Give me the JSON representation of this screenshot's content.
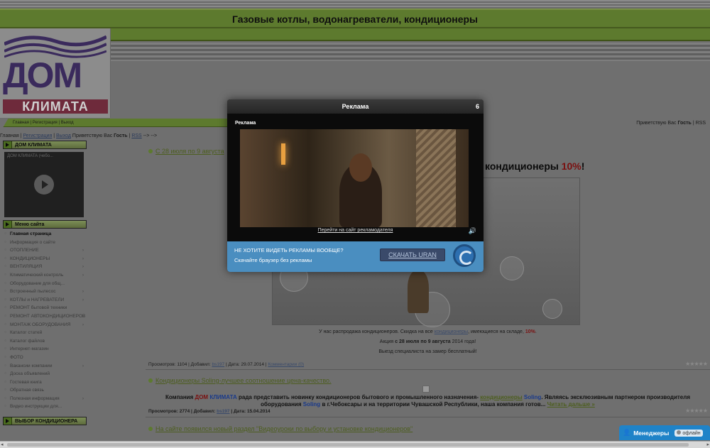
{
  "site": {
    "title": "Газовые котлы, водонагреватели, кондиционеры",
    "logo_top": "ДОМ",
    "logo_bottom": "КЛИМАТА"
  },
  "topnav": {
    "links": "Главная | Регистрация | Выход",
    "greeting_prefix": "Приветствую Вас",
    "greeting_user": "Гость",
    "rss": "RSS"
  },
  "secondnav": {
    "home": "Главная",
    "register": "Регистрация",
    "logout": "Выход",
    "greeting": "Приветствую Вас",
    "user": "Гость",
    "rss": "RSS",
    "tail": "--> -->"
  },
  "sidebar": {
    "block1_title": "ДОМ КЛИМАТА",
    "video_title": "ДОМ КЛИМАТА (чебо...",
    "block2_title": "Меню сайта",
    "menu": [
      {
        "label": "Главная страница",
        "active": true,
        "sub": false
      },
      {
        "label": "Информация о сайте",
        "active": false,
        "sub": false
      },
      {
        "label": "ОТОПЛЕНИЕ",
        "active": false,
        "sub": true
      },
      {
        "label": "КОНДИЦИОНЕРЫ",
        "active": false,
        "sub": true
      },
      {
        "label": "ВЕНТИЛЯЦИЯ",
        "active": false,
        "sub": true
      },
      {
        "label": "Климатический контроль",
        "active": false,
        "sub": true
      },
      {
        "label": "Оборудование для общ...",
        "active": false,
        "sub": false
      },
      {
        "label": "Встроенный пылесос",
        "active": false,
        "sub": true
      },
      {
        "label": "КОТЛЫ и НАГРЕВАТЕЛИ",
        "active": false,
        "sub": true
      },
      {
        "label": "РЕМОНТ бытовой техники",
        "active": false,
        "sub": false
      },
      {
        "label": "РЕМОНТ АВТОКОНДИЦИОНЕРОВ",
        "active": false,
        "sub": true
      },
      {
        "label": "МОНТАЖ ОБОРУДОВАНИЯ",
        "active": false,
        "sub": true
      },
      {
        "label": "Каталог статей",
        "active": false,
        "sub": false
      },
      {
        "label": "Каталог файлов",
        "active": false,
        "sub": false
      },
      {
        "label": "Интернет-магазин",
        "active": false,
        "sub": false
      },
      {
        "label": "ФОТО",
        "active": false,
        "sub": false
      },
      {
        "label": "Вакансии компании",
        "active": false,
        "sub": true
      },
      {
        "label": "Доска объявлений",
        "active": false,
        "sub": false
      },
      {
        "label": "Гостевая книга",
        "active": false,
        "sub": false
      },
      {
        "label": "Обратная связь",
        "active": false,
        "sub": false
      },
      {
        "label": "Полезная информация",
        "active": false,
        "sub": true
      },
      {
        "label": "Видео инструкции для...",
        "active": false,
        "sub": false
      }
    ],
    "block3_title": "ВЫБОР КОНДИЦИОНЕРА"
  },
  "content": {
    "article1_title": "С 28 июля по 9 августа",
    "headline_text": "кондиционеры",
    "headline_pct": "10%",
    "headline_tail": "!",
    "cap1_a": "У нас распродажа кондиционеров. Скидка на все",
    "cap1_link": "кондиционеры",
    "cap1_b": ", имеющиеся на складе,",
    "cap1_pct": "10%",
    "cap1_end": ".",
    "cap2_a": "Акция",
    "cap2_b": "с 28 июля по 9 августа",
    "cap2_c": "2014 года!",
    "cap3": "Выезд специалиста на замер бесплатный!",
    "meta1": {
      "views_label": "Просмотров:",
      "views": "1104",
      "added_label": "Добавил:",
      "author": "bs197",
      "date_label": "Дата:",
      "date": "29.07.2014",
      "comments": "Комментарии (0)"
    },
    "article2_title": "Кондиционеры Soling-лучшее соотношение цена-качество.",
    "a2_1": "Компания",
    "a2_dom": "ДОМ",
    "a2_klimata": "КЛИМАТА",
    "a2_2": "рада представить новинку кондиционеров бытового и промышленного назначения-",
    "a2_link1": "кондиционеры",
    "a2_soling": "Soling",
    "a2_3": ". Являясь эксклюзивным партнером производителя оборудования",
    "a2_soling2": "Soling",
    "a2_4": "в г.Чебоксары и на территории Чувашской Республики, наша компания готов...",
    "a2_more": "Читать дальше »",
    "meta2": {
      "views_label": "Просмотров:",
      "views": "2774",
      "added_label": "Добавил:",
      "author": "bs197",
      "date_label": "Дата:",
      "date": "15.04.2014"
    },
    "article3_title": "На сайте появился новый раздел \"Видеоуроки по выбору и установке кондиционеров\""
  },
  "ad": {
    "header": "Реклама",
    "countdown": "6",
    "label": "Реклама",
    "goto": "Перейти на сайт рекламодателя",
    "question": "НЕ ХОТИТЕ ВИДЕТЬ РЕКЛАМЫ ВООБЩЕ?",
    "suggest": "Скачайте браузер без рекламы",
    "download": "СКАЧАТЬ URAN"
  },
  "chat": {
    "label": "Менеджеры",
    "status": "офлайн"
  },
  "icons": {
    "stars": "★★★★★",
    "speaker": "🔊",
    "person": "👤"
  }
}
